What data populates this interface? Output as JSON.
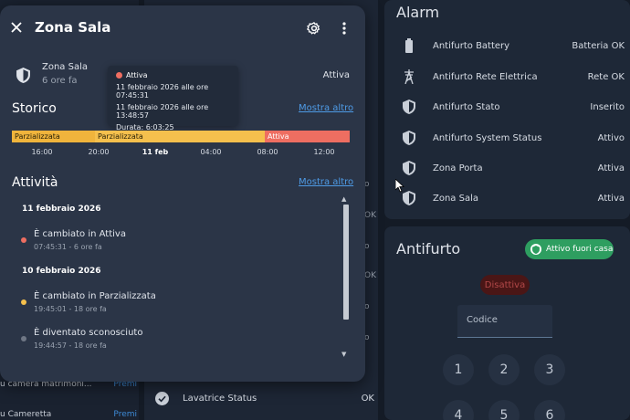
{
  "colors": {
    "dialog_bg": "#2b3547",
    "armed_red": "#ee6e61",
    "partial_yellow": "#f5c04d",
    "link_blue": "#4e9be6",
    "chip_green": "#2e9e60",
    "disarm_red": "#b24848"
  },
  "alarm_card": {
    "title": "Alarm",
    "rows": [
      {
        "name": "Antifurto Battery",
        "state": "Batteria OK",
        "icon": "battery-icon"
      },
      {
        "name": "Antifurto Rete Elettrica",
        "state": "Rete OK",
        "icon": "power-tower-icon"
      },
      {
        "name": "Antifurto Stato",
        "state": "Inserito",
        "icon": "shield-icon"
      },
      {
        "name": "Antifurto System Status",
        "state": "Attivo",
        "icon": "shield-icon"
      },
      {
        "name": "Zona Porta",
        "state": "Attiva",
        "icon": "shield-icon"
      },
      {
        "name": "Zona Sala",
        "state": "Attiva",
        "icon": "shield-icon"
      }
    ]
  },
  "antifurto_card": {
    "title": "Antifurto",
    "mode_chip": "Attivo fuori casa",
    "disarm_label": "Disattiva",
    "code_placeholder": "Codice",
    "keys": [
      "1",
      "2",
      "3",
      "4",
      "5",
      "6"
    ]
  },
  "mid_column": {
    "row": {
      "name": "Lavatrice Status",
      "state": "OK"
    },
    "peek_values": [
      "o",
      "OK",
      "o",
      "OK",
      "o",
      "o"
    ]
  },
  "left_column": {
    "rows": [
      {
        "label": "u camera matrimoni...",
        "action": "Premi"
      },
      {
        "label": "u Cameretta",
        "action": "Premi"
      }
    ]
  },
  "dialog": {
    "title": "Zona Sala",
    "entity": {
      "name": "Zona Sala",
      "time": "6 ore fa",
      "state": "Attiva"
    },
    "history": {
      "title": "Storico",
      "show_more": "Mostra altro",
      "tooltip": {
        "state": "Attiva",
        "from": "11 febbraio 2026 alle ore 07:45:31",
        "to": "11 febbraio 2026 alle ore 13:48:57",
        "duration": "Durata: 6:03:25"
      },
      "segments": [
        {
          "label": "Parzializzata",
          "color": "#f0b43c",
          "start": "14:45",
          "end": "19:45"
        },
        {
          "label": "Parzializzata",
          "color": "#f5c04d",
          "start": "19:45",
          "end": "07:45"
        },
        {
          "label": "Attiva",
          "color": "#ee6e61",
          "start": "07:45",
          "end": "13:49"
        }
      ],
      "ticks": [
        {
          "label": "16:00",
          "bold": false
        },
        {
          "label": "20:00",
          "bold": false
        },
        {
          "label": "11 feb",
          "bold": true
        },
        {
          "label": "04:00",
          "bold": false
        },
        {
          "label": "08:00",
          "bold": false
        },
        {
          "label": "12:00",
          "bold": false
        }
      ]
    },
    "logbook": {
      "title": "Attività",
      "show_more": "Mostra altro",
      "groups": [
        {
          "date": "11 febbraio 2026",
          "entries": [
            {
              "text": "È cambiato in Attiva",
              "time": "07:45:31 - 6 ore fa",
              "color": "#ee6e61"
            }
          ]
        },
        {
          "date": "10 febbraio 2026",
          "entries": [
            {
              "text": "È cambiato in Parzializzata",
              "time": "19:45:01 - 18 ore fa",
              "color": "#f5c04d"
            },
            {
              "text": "È diventato sconosciuto",
              "time": "19:44:57 - 18 ore fa",
              "color": "#6f7785"
            }
          ]
        }
      ]
    }
  }
}
